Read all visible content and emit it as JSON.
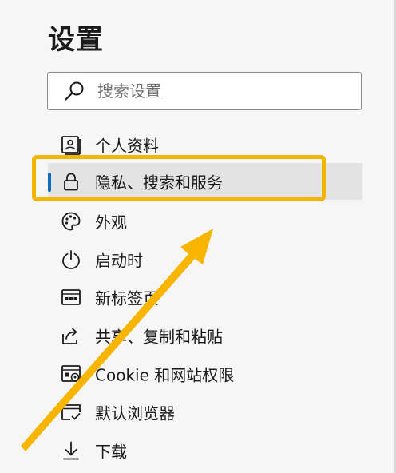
{
  "header": {
    "title": "设置"
  },
  "search": {
    "placeholder": "搜索设置",
    "icon": "search-icon"
  },
  "nav": {
    "items": [
      {
        "label": "个人资料",
        "icon": "profile-icon",
        "selected": false
      },
      {
        "label": "隐私、搜索和服务",
        "icon": "lock-icon",
        "selected": true
      },
      {
        "label": "外观",
        "icon": "palette-icon",
        "selected": false
      },
      {
        "label": "启动时",
        "icon": "power-icon",
        "selected": false
      },
      {
        "label": "新标签页",
        "icon": "new-tab-icon",
        "selected": false
      },
      {
        "label": "共享、复制和粘贴",
        "icon": "share-icon",
        "selected": false
      },
      {
        "label": "Cookie 和网站权限",
        "icon": "site-permissions-icon",
        "selected": false
      },
      {
        "label": "默认浏览器",
        "icon": "default-browser-icon",
        "selected": false
      },
      {
        "label": "下载",
        "icon": "download-icon",
        "selected": false
      }
    ]
  },
  "colors": {
    "accent": "#0f6cbd",
    "highlight": "#f7b500",
    "selected_bg": "#e3e3e3",
    "page_bg": "#f6f6f6"
  }
}
